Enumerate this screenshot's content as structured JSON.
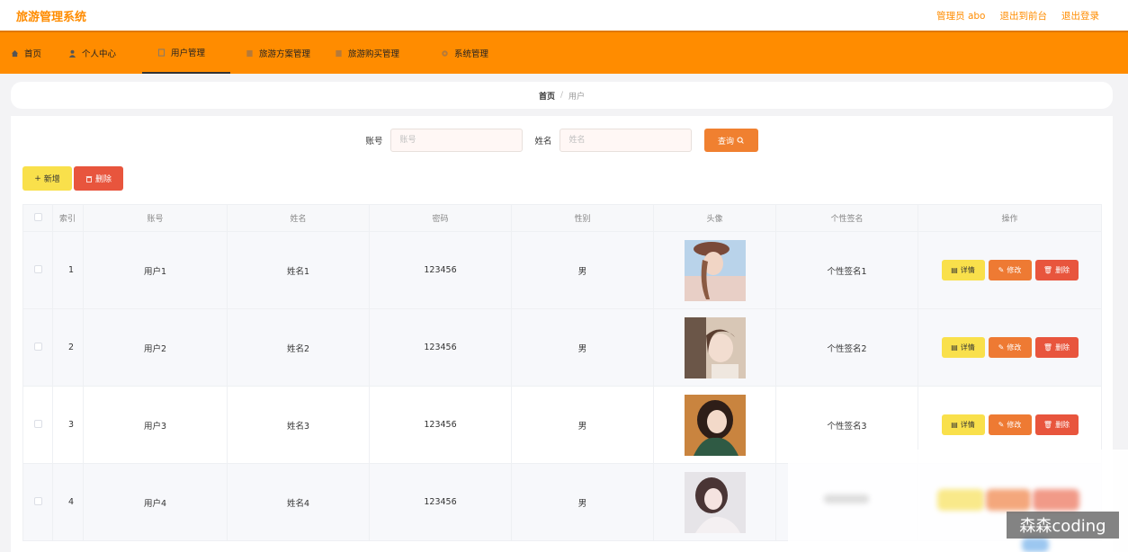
{
  "header": {
    "brand": "旅游管理系统",
    "admin_label": "管理员 abo",
    "front_link": "退出到前台",
    "logout_link": "退出登录"
  },
  "nav": {
    "items": [
      {
        "label": "首页",
        "icon": "home-icon"
      },
      {
        "label": "个人中心",
        "icon": "user-icon"
      },
      {
        "label": "用户管理",
        "icon": "doc-icon",
        "active": true
      },
      {
        "label": "旅游方案管理",
        "icon": "doc-icon"
      },
      {
        "label": "旅游购买管理",
        "icon": "doc-icon"
      },
      {
        "label": "系统管理",
        "icon": "gear-icon"
      }
    ]
  },
  "breadcrumb": {
    "home": "首页",
    "sep": "/",
    "current": "用户"
  },
  "search": {
    "account_label": "账号",
    "account_placeholder": "账号",
    "name_label": "姓名",
    "name_placeholder": "姓名",
    "query_button": "查询"
  },
  "actions": {
    "add": "新增",
    "delete": "删除"
  },
  "table": {
    "headers": [
      "索引",
      "账号",
      "姓名",
      "密码",
      "性别",
      "头像",
      "个性签名",
      "操作"
    ],
    "row_buttons": {
      "detail": "详情",
      "edit": "修改",
      "delete": "删除"
    },
    "rows": [
      {
        "index": "1",
        "account": "用户1",
        "name": "姓名1",
        "password": "123456",
        "gender": "男",
        "signature": "个性签名1"
      },
      {
        "index": "2",
        "account": "用户2",
        "name": "姓名2",
        "password": "123456",
        "gender": "男",
        "signature": "个性签名2"
      },
      {
        "index": "3",
        "account": "用户3",
        "name": "姓名3",
        "password": "123456",
        "gender": "男",
        "signature": "个性签名3"
      },
      {
        "index": "4",
        "account": "用户4",
        "name": "姓名4",
        "password": "123456",
        "gender": "男",
        "signature": ""
      }
    ]
  },
  "watermark": "森森coding",
  "colors": {
    "accent": "#ff8c00",
    "query": "#f08030",
    "add": "#f9e04b",
    "danger": "#e8553d",
    "edit": "#ee7a33"
  }
}
